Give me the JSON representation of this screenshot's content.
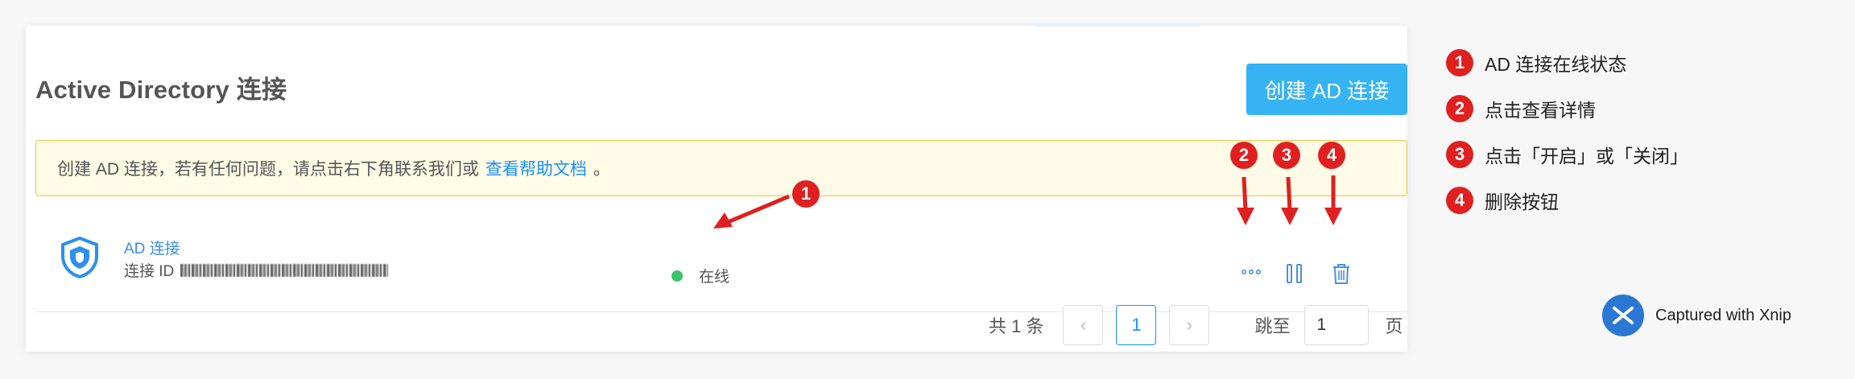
{
  "page": {
    "title": "Active Directory 连接",
    "create_button": "创建 AD 连接"
  },
  "notice": {
    "text": "创建 AD 连接，若有任何问题，请点击右下角联系我们或",
    "link": "查看帮助文档",
    "suffix": "。"
  },
  "connection": {
    "name": "AD 连接",
    "id_label": "连接 ID",
    "status": "在线"
  },
  "pagination": {
    "total": "共 1 条",
    "current_page": "1",
    "jump_label": "跳至",
    "jump_value": "1",
    "unit": "页"
  },
  "annotations": {
    "badges": [
      "1",
      "2",
      "3",
      "4"
    ],
    "legend": [
      {
        "num": "1",
        "text": "AD 连接在线状态"
      },
      {
        "num": "2",
        "text": "点击查看详情"
      },
      {
        "num": "3",
        "text": "点击「开启」或「关闭」"
      },
      {
        "num": "4",
        "text": "删除按钮"
      }
    ]
  },
  "watermark": "Captured with Xnip",
  "colors": {
    "primary": "#36b3f3",
    "link": "#1890ff",
    "online": "#3cc36b",
    "annotation_red": "#e02020",
    "notice_bg": "#fffbe6",
    "notice_border": "#f1c34a"
  },
  "icons": {
    "connection": "shield-icon",
    "more": "ellipsis-icon",
    "pause": "pause-icon",
    "delete": "trash-icon"
  }
}
